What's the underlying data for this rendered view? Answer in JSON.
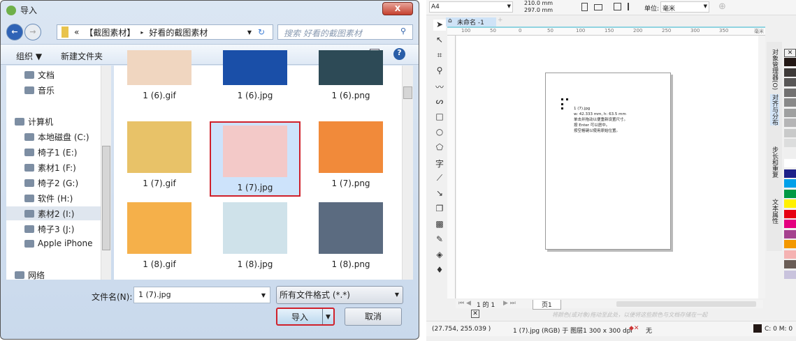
{
  "dialog": {
    "title": "导入",
    "close": "X",
    "breadcrumb": [
      "«",
      "【截图素材】",
      "▸",
      "好看的截图素材"
    ],
    "search_placeholder": "搜索 好看的截图素材",
    "toolbar": {
      "organize": "组织 ▼",
      "new_folder": "新建文件夹"
    },
    "sidebar": [
      {
        "label": "文档",
        "icon": "document-icon"
      },
      {
        "label": "音乐",
        "icon": "music-icon"
      },
      {
        "label": "计算机",
        "icon": "computer-icon"
      },
      {
        "label": "本地磁盘 (C:)",
        "icon": "drive-icon"
      },
      {
        "label": "椅子1 (E:)",
        "icon": "drive-icon"
      },
      {
        "label": "素材1 (F:)",
        "icon": "drive-icon"
      },
      {
        "label": "椅子2 (G:)",
        "icon": "drive-icon"
      },
      {
        "label": "软件 (H:)",
        "icon": "drive-icon"
      },
      {
        "label": "素材2 (I:)",
        "icon": "drive-icon"
      },
      {
        "label": "椅子3 (J:)",
        "icon": "drive-icon"
      },
      {
        "label": "Apple iPhone",
        "icon": "phone-icon"
      },
      {
        "label": "网络",
        "icon": "network-icon"
      }
    ],
    "files": [
      {
        "name": "1 (6).gif",
        "color": "#f0d6c0"
      },
      {
        "name": "1 (6).jpg",
        "color": "#1a4fa8"
      },
      {
        "name": "1 (6).png",
        "color": "#2d4a56"
      },
      {
        "name": "1 (7).gif",
        "color": "#e8c268"
      },
      {
        "name": "1 (7).jpg",
        "color": "#f3c9c8",
        "selected": true
      },
      {
        "name": "1 (7).png",
        "color": "#f18a3a"
      },
      {
        "name": "1 (8).gif",
        "color": "#f5b04a"
      },
      {
        "name": "1 (8).jpg",
        "color": "#cfe2ea"
      },
      {
        "name": "1 (8).png",
        "color": "#5b6b80"
      }
    ],
    "filename_label": "文件名(N):",
    "filename_value": "1 (7).jpg",
    "filetype": "所有文件格式 (*.*)",
    "import_btn": "导入",
    "cancel_btn": "取消"
  },
  "corel": {
    "page_size": "A4",
    "width": "210.0 mm",
    "height": "297.0 mm",
    "unit_label": "单位:",
    "unit": "毫米",
    "doc_tab": "未命名 -1",
    "ruler": [
      "100",
      "50",
      "0",
      "50",
      "100",
      "150",
      "200",
      "250",
      "300",
      "350"
    ],
    "ruler_unit": "毫米",
    "tooltip": [
      "1 (7).jpg",
      "w: 42.333 mm, h: 63.5 mm",
      "单击并拖动以便重新设置尺寸。",
      "按 Enter 可以居中。",
      "按空格键以使用原始位置。"
    ],
    "dockers": [
      "对象管理器(O)",
      "对齐与分布",
      "步长和重复",
      "文本属性"
    ],
    "page_nav": "1 的 1",
    "page_tab": "页1",
    "palette_hint": "将颜色(或对象)拖动至此处，以便将这些颜色与文档存储在一起",
    "status": {
      "coords": "(27.754, 255.039 )",
      "object": "1 (7).jpg (RGB) 于 图层1 300 x 300 dpi",
      "fill": "无",
      "color": "C: 0 M: 0"
    },
    "palette": [
      "#231815",
      "#3e3a39",
      "#595757",
      "#727171",
      "#898989",
      "#9fa0a0",
      "#b5b5b6",
      "#c9caca",
      "#dcdddd",
      "#efefef",
      "#ffffff",
      "#1d2088",
      "#00a0e9",
      "#009944",
      "#fff100",
      "#e60012",
      "#e4007f",
      "#a5418e",
      "#f39800",
      "#f5b2b2",
      "#6a5d56",
      "#c9c3dd"
    ]
  }
}
